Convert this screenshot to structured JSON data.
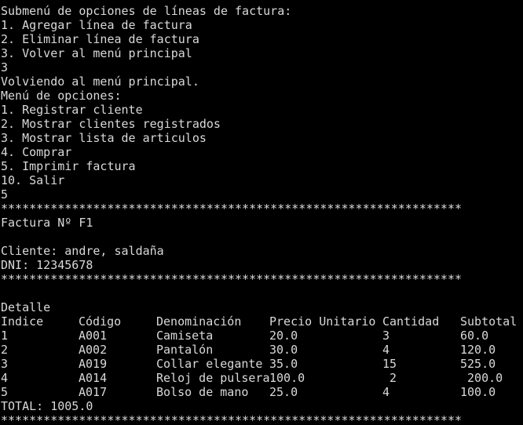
{
  "terminal": {
    "lines_top": [
      "Submenú de opciones de líneas de factura:",
      "1. Agregar línea de factura",
      "2. Eliminar línea de factura",
      "3. Volver al menú principal",
      "3",
      "Volviendo al menú principal.",
      "Menú de opciones:",
      "1. Registrar cliente",
      "2. Mostrar clientes registrados",
      "3. Mostrar lista de articulos",
      "4. Comprar",
      "5. Imprimir factura",
      "10. Salir",
      "5",
      "*****************************************************************",
      "Factura Nº F1",
      "",
      "Cliente: andre, saldaña",
      "DNI: 12345678",
      "*****************************************************************",
      "",
      "Detalle"
    ],
    "table": {
      "headers": [
        "Indice",
        "Código",
        "Denominación",
        "Precio Unitario",
        "Cantidad",
        "Subtotal"
      ],
      "rows": [
        [
          "1",
          "A001",
          "Camiseta",
          "20.0",
          "3",
          "60.0"
        ],
        [
          "2",
          "A002",
          "Pantalón",
          "30.0",
          "4",
          "120.0"
        ],
        [
          "3",
          "A019",
          "Collar elegante",
          "35.0",
          "15",
          "525.0"
        ],
        [
          "4",
          "A014",
          "Reloj de pulsera",
          "100.0",
          " 2",
          " 200.0"
        ],
        [
          "5",
          "A017",
          "Bolso de mano",
          "25.0",
          "4",
          "100.0"
        ]
      ]
    },
    "total_line": "TOTAL: 1005.0",
    "separator_bottom": "*****************************************************************"
  }
}
